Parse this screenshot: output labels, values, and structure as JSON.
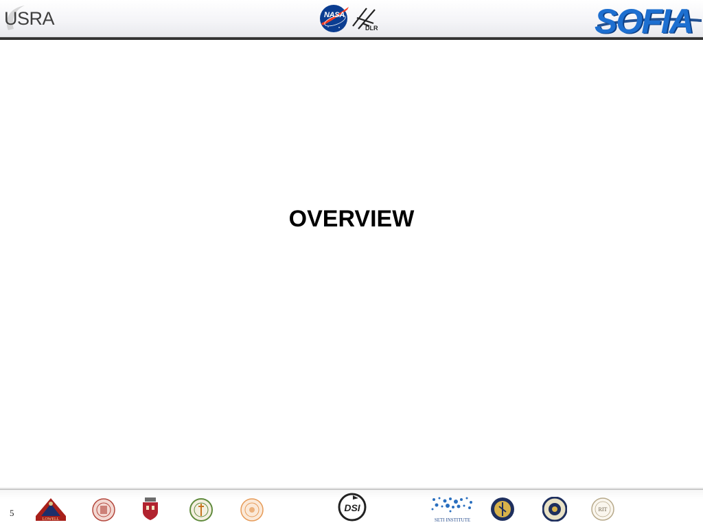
{
  "header": {
    "usra_logo": {
      "text": "USRA",
      "icon": "usra-logo"
    },
    "nasa_logo": {
      "text": "NASA",
      "icon": "nasa-meatball-logo"
    },
    "dlr_logo": {
      "text": "DLR",
      "icon": "dlr-logo"
    },
    "sofia_logo": {
      "text": "SOFIA",
      "icon": "sofia-logo"
    }
  },
  "slide": {
    "title": "OVERVIEW",
    "page_number": "5"
  },
  "footer": {
    "logos": [
      {
        "name": "lowell-observatory-logo",
        "text": "LOWELL"
      },
      {
        "name": "cornell-seal-logo",
        "text": ""
      },
      {
        "name": "university-shield-logo",
        "text": ""
      },
      {
        "name": "university-seal-green-logo",
        "text": ""
      },
      {
        "name": "university-seal-orange-logo",
        "text": ""
      },
      {
        "name": "dsi-logo",
        "text": "DSI"
      },
      {
        "name": "seti-institute-logo",
        "text": "SETI INSTITUTE"
      },
      {
        "name": "university-seal-gold-logo",
        "text": ""
      },
      {
        "name": "university-seal-navy-logo",
        "text": ""
      },
      {
        "name": "rit-logo",
        "text": "RIT"
      }
    ]
  },
  "colors": {
    "sofia_blue": "#1d6fd0",
    "nasa_blue": "#0b3d91",
    "nasa_red": "#fc3d21",
    "header_rule": "#1a1a1a"
  }
}
